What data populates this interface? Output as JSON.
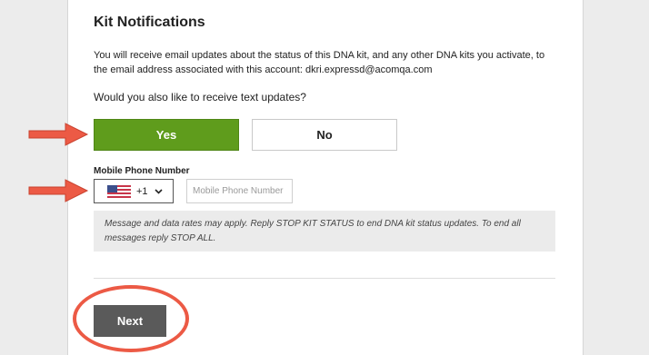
{
  "section": {
    "title": "Kit Notifications",
    "description": "You will receive email updates about the status of this DNA kit, and any other DNA kits you activate, to the email address associated with this account: dkri.expressd@acomqa.com",
    "question": "Would you also like to receive text updates?"
  },
  "choice": {
    "yes_label": "Yes",
    "no_label": "No",
    "selected": "Yes"
  },
  "phone": {
    "label": "Mobile Phone Number",
    "country_code": "+1",
    "country_flag": "us-flag-icon",
    "placeholder": "Mobile Phone Number",
    "value": ""
  },
  "notice": {
    "text": "Message and data rates may apply. Reply STOP KIT STATUS to end DNA kit status updates. To end all messages reply STOP ALL."
  },
  "footer": {
    "next_label": "Next"
  },
  "colors": {
    "yes_green": "#5f9c1c",
    "next_gray": "#5a5a5a",
    "annotation_red": "#ec5a45",
    "notice_bg": "#ebebeb"
  }
}
